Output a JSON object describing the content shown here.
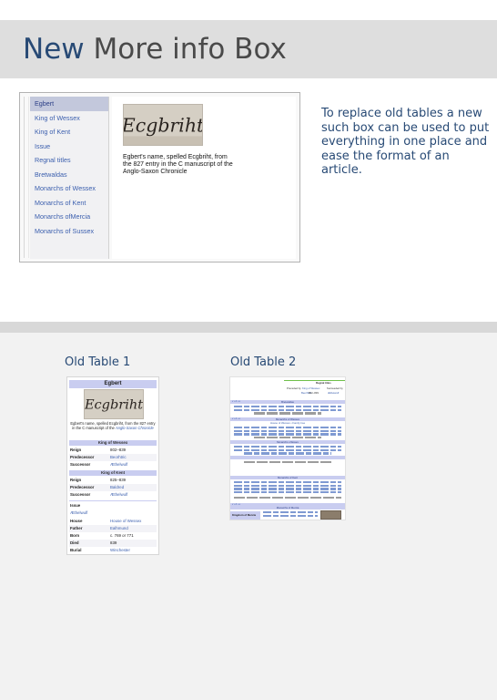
{
  "slide": {
    "title_accent": "New",
    "title_rest": " More info Box",
    "side_note": "To replace old tables a new such box can be used to put everything in one place and ease the format of an article."
  },
  "new_box": {
    "menu_items": [
      "Egbert",
      "King of Wessex",
      "King of Kent",
      "Issue",
      "Regnal titles",
      "Bretwaldas",
      "Monarchs of Wessex",
      "Monarchs of Kent",
      "Monarchs ofMercia",
      "Monarchs of Sussex"
    ],
    "active_index": 0,
    "image_text": "Ecgbriht",
    "caption": "Egbert's name, spelled Ecgbriht, from the 827 entry in the C manuscript of the Anglo-Saxon Chronicle"
  },
  "old_table_1": {
    "heading": "Old Table 1",
    "title": "Egbert",
    "caption_prefix": "Egbert's name, spelled Ecgbriht, from the 827 entry in the C manuscript of the ",
    "caption_link": "Anglo-Saxon Chronicle",
    "wessex_header": "King of Wessex",
    "wessex_rows": [
      {
        "k": "Reign",
        "v": "802–839"
      },
      {
        "k": "Predecessor",
        "v": "Beorhtric"
      },
      {
        "k": "Successor",
        "v": "Æthelwulf"
      }
    ],
    "kent_header": "King of Kent",
    "kent_rows": [
      {
        "k": "Reign",
        "v": "825–839"
      },
      {
        "k": "Predecessor",
        "v": "Baldred"
      },
      {
        "k": "Successor",
        "v": "Æthelwulf"
      }
    ],
    "issue_label": "Issue",
    "issue_value": "Æthelwulf",
    "personal_rows": [
      {
        "k": "House",
        "v": "House of Wessex"
      },
      {
        "k": "Father",
        "v": "Ealhmund"
      },
      {
        "k": "Born",
        "v": "c. 769 or 771"
      },
      {
        "k": "Died",
        "v": "839"
      },
      {
        "k": "Burial",
        "v": "Winchester"
      }
    ]
  },
  "old_table_2": {
    "heading": "Old Table 2",
    "regnal_titles": "Regnal titles",
    "preceded_by": "Preceded by",
    "preceded_name": "Beorhtric",
    "king_of_wessex": "King of Wessex",
    "reign": "802–839",
    "succeeded_by": "Succeeded by",
    "succeeded_name": "Æthelwulf",
    "vde": "v • d • e",
    "bretwaldas": "Bretwaldas",
    "monarchs_wessex": "Monarchs of Wessex",
    "house_wessex": "House of Wessex • Family tree",
    "monarchs_essex": "Monarchs of Essex",
    "monarchs_kent": "Monarchs of Kent",
    "monarchs_mercia": "Monarchs of Mercia",
    "kingdom_mercia": "Kingdom of Mercia"
  }
}
